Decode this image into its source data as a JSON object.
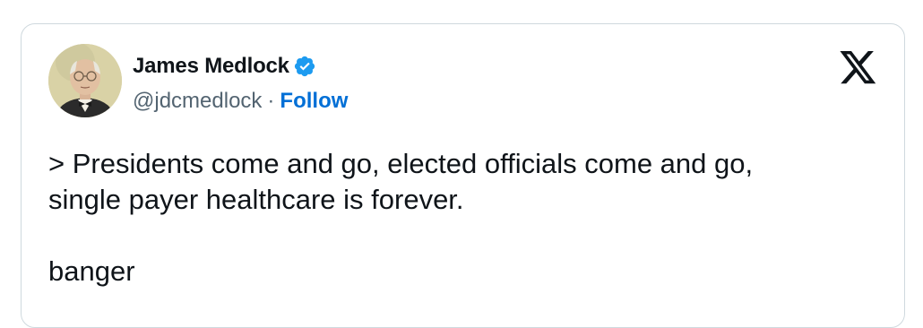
{
  "author": {
    "display_name": "James Medlock",
    "handle": "@jdcmedlock",
    "separator": "·",
    "follow_label": "Follow",
    "verified_color": "#1d9bf0",
    "avatar_icon": "portrait-avatar"
  },
  "brand": {
    "logo_icon": "x-logo-icon",
    "color": "#0f1419"
  },
  "tweet": {
    "text": "> Presidents come and go, elected officials come and go,\nsingle payer healthcare is forever.\n\nbanger"
  },
  "colors": {
    "text": "#0f1419",
    "secondary": "#536471",
    "link": "#006fd6",
    "border": "#cfd9de"
  }
}
